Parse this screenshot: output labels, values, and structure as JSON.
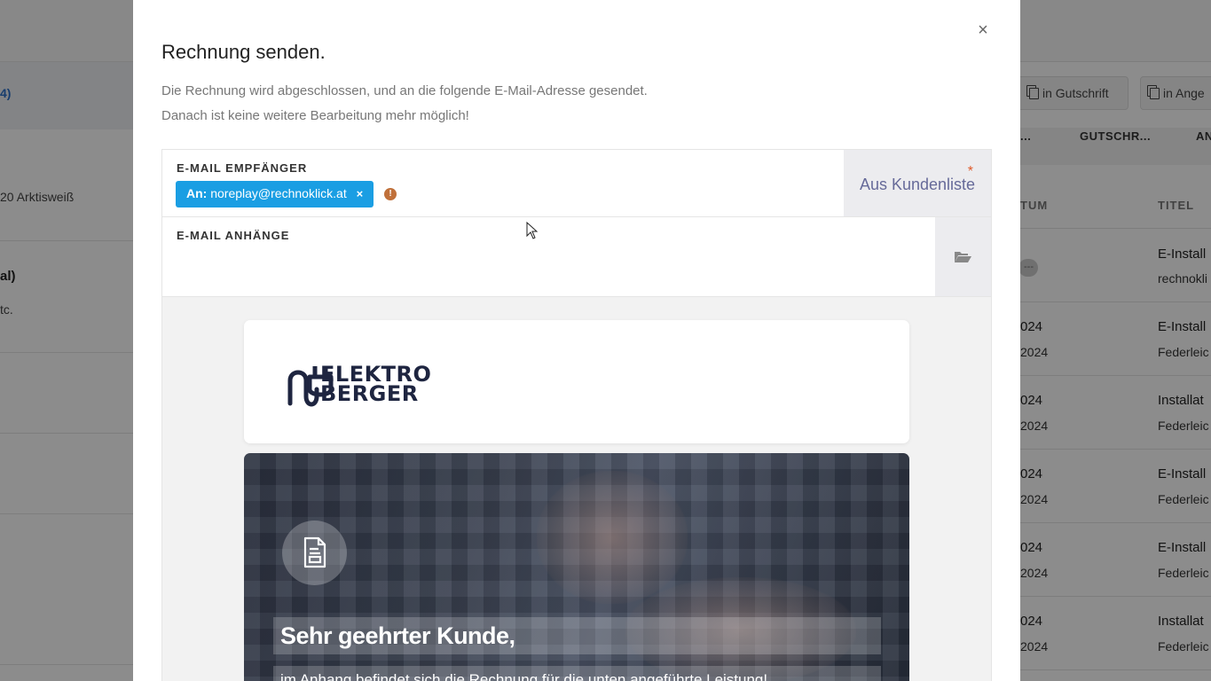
{
  "background": {
    "left": {
      "link_text": "4)",
      "row1": "20 Arktisweiß",
      "row2_a": "al)",
      "row2_b": "tc."
    },
    "right": {
      "buttons": [
        {
          "label": "in Gutschrift"
        },
        {
          "label": "in Ange"
        }
      ],
      "tabs": [
        "...",
        "GUTSCHR...",
        "AN"
      ],
      "headers": {
        "datum": "TUM",
        "titel": "TITEL"
      },
      "pill": "---",
      "rows": [
        {
          "date1": "",
          "date2": "",
          "title": "E-Install",
          "sub": "rechnokli"
        },
        {
          "date1": "024",
          "date2": "2024",
          "title": "E-Install",
          "sub": "Federleic"
        },
        {
          "date1": "024",
          "date2": "2024",
          "title": "Installat",
          "sub": "Federleic"
        },
        {
          "date1": "024",
          "date2": "2024",
          "title": "E-Install",
          "sub": "Federleic"
        },
        {
          "date1": "024",
          "date2": "2024",
          "title": "E-Install",
          "sub": "Federleic"
        },
        {
          "date1": "024",
          "date2": "2024",
          "title": "Installat",
          "sub": "Federleic"
        }
      ]
    }
  },
  "modal": {
    "close_glyph": "×",
    "title": "Rechnung senden.",
    "description_line1": "Die Rechnung wird abgeschlossen, und an die folgende E-Mail-Adresse gesendet.",
    "description_line2": "Danach ist keine weitere Bearbeitung mehr möglich!",
    "recipient": {
      "label": "E-MAIL EMPFÄNGER",
      "chip_prefix": "An:",
      "chip_email": "noreplay@rechnoklick.at",
      "chip_remove": "×",
      "warning_glyph": "!",
      "customer_list_button": "Aus Kundenliste",
      "required_mark": "*"
    },
    "attachments": {
      "label": "E-MAIL ANHÄNGE",
      "folder_icon": "folder-open-icon"
    },
    "preview": {
      "logo_line1": "ELEKTRO",
      "logo_line2": "BERGER",
      "greeting": "Sehr geehrter Kunde,",
      "body_line": "im Anhang befindet sich die Rechnung für die unten angeführte Leistung!"
    }
  },
  "colors": {
    "chip_bg": "#1a9ee3",
    "warning": "#c0703a",
    "link_blue": "#666a99",
    "required": "#e05a2a",
    "logo": "#1e2540"
  }
}
